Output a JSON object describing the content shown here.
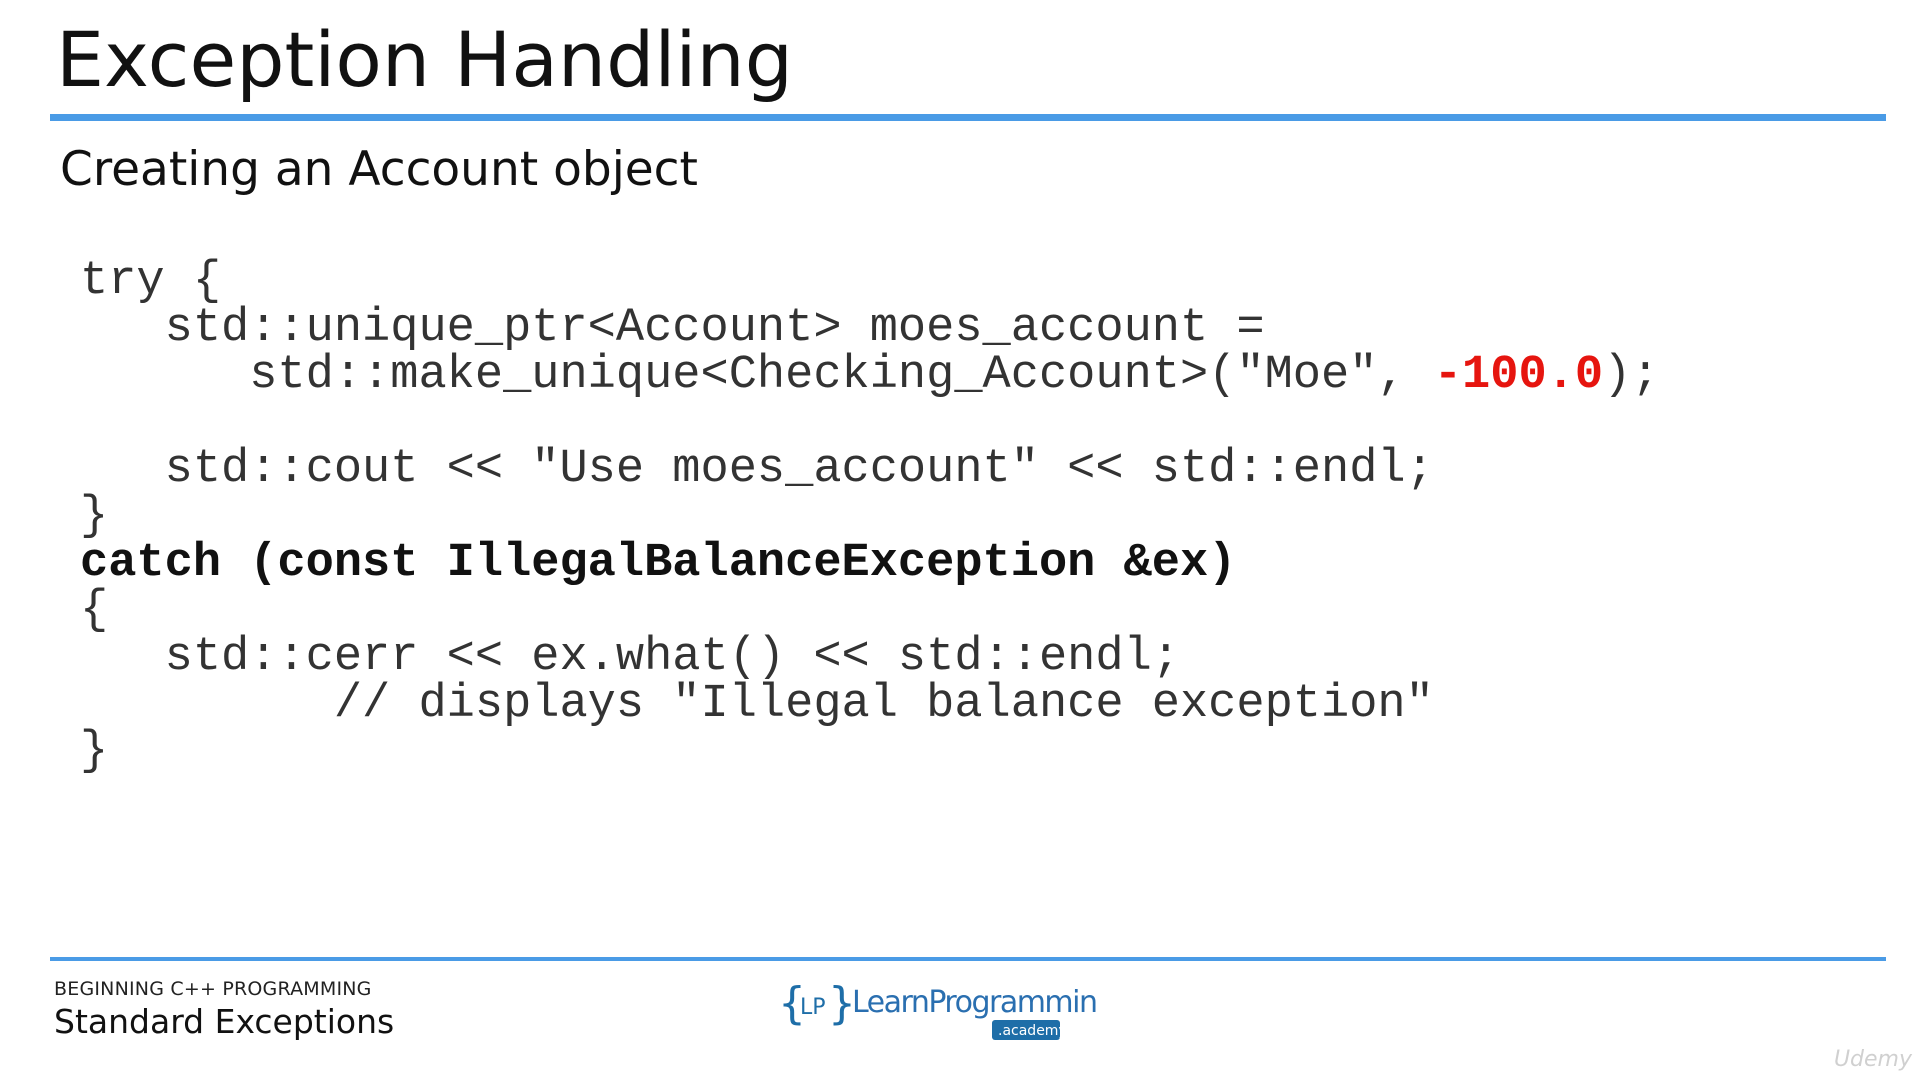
{
  "slide": {
    "title": "Exception Handling",
    "subtitle": "Creating an Account object"
  },
  "code": {
    "lines": [
      "try {",
      "   std::unique_ptr<Account> moes_account =",
      "      std::make_unique<Checking_Account>(\"Moe\", ",
      "-100.0",
      ");",
      "",
      "   std::cout << \"Use moes_account\" << std::endl;",
      "}",
      "catch (const IllegalBalanceException &ex)",
      "{",
      "   std::cerr << ex.what() << std::endl;",
      "         // displays \"Illegal balance exception\"",
      "}"
    ]
  },
  "footer": {
    "course": "BEGINNING C++ PROGRAMMING",
    "section": "Standard Exceptions",
    "logo_text": "LearnProgramming",
    "logo_sub": ".academy",
    "logo_initials": "LP",
    "watermark": "Udemy"
  },
  "colors": {
    "accent": "#4a9be6",
    "highlight": "#e6150f"
  }
}
